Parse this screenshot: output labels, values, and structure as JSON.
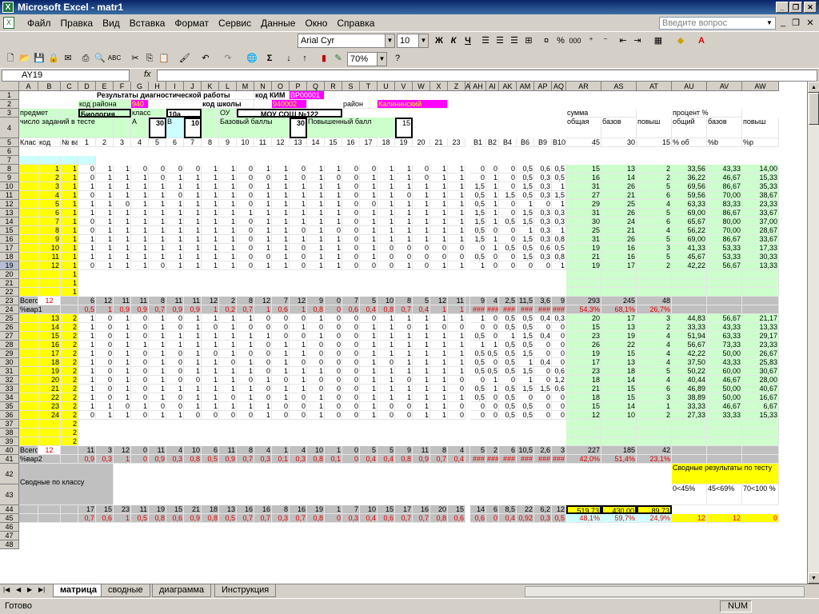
{
  "window": {
    "title": "Microsoft Excel - matr1",
    "icon": "excel-icon",
    "min": "_",
    "restore": "❐",
    "close": "✕"
  },
  "menu": [
    "Файл",
    "Правка",
    "Вид",
    "Вставка",
    "Формат",
    "Сервис",
    "Данные",
    "Окно",
    "Справка"
  ],
  "help_placeholder": "Введите вопрос",
  "toolbar": {
    "font": "Arial Cyr",
    "size": "10",
    "bold": "Ж",
    "italic": "К",
    "underline": "Ч",
    "zoom": "70%",
    "currency": "%",
    "thousands": "000"
  },
  "formula": {
    "cell": "AY19",
    "fx": "fx",
    "value": ""
  },
  "columns": [
    "A",
    "B",
    "C",
    "D",
    "E",
    "F",
    "G",
    "H",
    "I",
    "J",
    "K",
    "L",
    "M",
    "N",
    "O",
    "P",
    "Q",
    "R",
    "S",
    "T",
    "U",
    "V",
    "W",
    "X",
    "Z",
    "A",
    "AH",
    "AI",
    "AK",
    "AM",
    "AP",
    "AQ",
    "AR",
    "AS",
    "AT",
    "AU",
    "AV",
    "AW"
  ],
  "rows_visible": [
    "1",
    "2",
    "3",
    "4",
    "5",
    "6",
    "7",
    "8",
    "9",
    "10",
    "11",
    "12",
    "13",
    "14",
    "15",
    "16",
    "17",
    "18",
    "19",
    "20",
    "21",
    "22",
    "23",
    "24",
    "25",
    "26",
    "27",
    "28",
    "29",
    "30",
    "31",
    "32",
    "33",
    "34",
    "35",
    "36",
    "37",
    "38",
    "39",
    "40",
    "41",
    "42",
    "43",
    "44",
    "45",
    "46",
    "47",
    "48"
  ],
  "header": {
    "title": "Результаты диагностической работы",
    "kim_label": "код КИМ",
    "kim": "BP00001",
    "district_code_label": "код района",
    "district_code": "940",
    "school_code_label": "код школы",
    "school_code": "940002",
    "district_label": "район",
    "district": "Калининский",
    "subject_label": "предмет",
    "subject": "Биология",
    "class_label": "класс",
    "class": "10а",
    "ou_label": "ОУ",
    "ou": "МОУ СОШ №122",
    "tasks_label": "число заданий в тесте",
    "a_label": "А",
    "a_count": "30",
    "b_label": "В",
    "b_count": "10",
    "base_label": "Базовый баллы",
    "base": "30",
    "adv_label": "Повышенный балл",
    "adv": "15",
    "sum_label": "сумма",
    "pct_label": "процент %",
    "total": "общая",
    "base_col": "базов",
    "adv_col": "повыш",
    "pct_total": "общий",
    "pct_base": "базов",
    "pct_adv": "повыш",
    "class_h": "Клас с",
    "code_h": "код",
    "var_h": "№ вар",
    "total_max": "45",
    "base_max": "30",
    "adv_max": "15",
    "pct_h1": "% об",
    "pct_h2": "%b",
    "pct_h3": "%p",
    "task_nums": [
      "1",
      "2",
      "3",
      "4",
      "5",
      "6",
      "7",
      "8",
      "9",
      "10",
      "11",
      "12",
      "13",
      "14",
      "15",
      "16",
      "17",
      "18",
      "19",
      "20",
      "21",
      "23",
      "B1",
      "B2",
      "B4",
      "B6",
      "B9",
      "B10"
    ]
  },
  "block1": [
    {
      "code": "1",
      "var": "1",
      "v": [
        "0",
        "1",
        "1",
        "0",
        "0",
        "0",
        "0",
        "1",
        "1",
        "0",
        "1",
        "1",
        "0",
        "1",
        "1",
        "0",
        "0",
        "1",
        "1",
        "0",
        "1",
        "1",
        "0",
        "0",
        "0",
        "0,5",
        "0,6",
        "0,5"
      ],
      "s": [
        "15",
        "13",
        "2"
      ],
      "p": [
        "33,56",
        "43,33",
        "14,00"
      ]
    },
    {
      "code": "2",
      "var": "1",
      "v": [
        "0",
        "1",
        "1",
        "1",
        "0",
        "1",
        "1",
        "1",
        "1",
        "0",
        "0",
        "1",
        "0",
        "1",
        "0",
        "0",
        "1",
        "1",
        "1",
        "0",
        "1",
        "1",
        "0",
        "1",
        "0",
        "0,5",
        "0,3",
        "0,5"
      ],
      "s": [
        "16",
        "14",
        "2"
      ],
      "p": [
        "36,22",
        "46,67",
        "15,33"
      ]
    },
    {
      "code": "3",
      "var": "1",
      "v": [
        "1",
        "1",
        "1",
        "1",
        "1",
        "1",
        "1",
        "1",
        "1",
        "0",
        "1",
        "1",
        "1",
        "1",
        "1",
        "0",
        "1",
        "1",
        "1",
        "1",
        "1",
        "1",
        "1,5",
        "1",
        "0",
        "1,5",
        "0,3",
        "1"
      ],
      "s": [
        "31",
        "26",
        "5"
      ],
      "p": [
        "69,56",
        "86,67",
        "35,33"
      ]
    },
    {
      "code": "4",
      "var": "1",
      "v": [
        "0",
        "1",
        "1",
        "1",
        "1",
        "0",
        "1",
        "1",
        "1",
        "0",
        "1",
        "1",
        "1",
        "1",
        "1",
        "0",
        "1",
        "1",
        "0",
        "1",
        "1",
        "1",
        "0,5",
        "1",
        "1,5",
        "0,5",
        "0,3",
        "1,5"
      ],
      "s": [
        "27",
        "21",
        "6"
      ],
      "p": [
        "59,56",
        "70,00",
        "38,67"
      ]
    },
    {
      "code": "5",
      "var": "1",
      "v": [
        "1",
        "1",
        "0",
        "1",
        "1",
        "1",
        "1",
        "1",
        "1",
        "0",
        "1",
        "1",
        "1",
        "1",
        "1",
        "0",
        "0",
        "1",
        "1",
        "1",
        "1",
        "1",
        "0,5",
        "1",
        "0",
        "1",
        "0",
        "1"
      ],
      "s": [
        "29",
        "25",
        "4"
      ],
      "p": [
        "63,33",
        "83,33",
        "23,33"
      ]
    },
    {
      "code": "6",
      "var": "1",
      "v": [
        "1",
        "1",
        "1",
        "1",
        "1",
        "1",
        "1",
        "1",
        "1",
        "1",
        "1",
        "1",
        "1",
        "1",
        "1",
        "0",
        "1",
        "1",
        "1",
        "1",
        "1",
        "1",
        "1,5",
        "1",
        "0",
        "1,5",
        "0,3",
        "0,3"
      ],
      "s": [
        "31",
        "26",
        "5"
      ],
      "p": [
        "69,00",
        "86,67",
        "33,67"
      ]
    },
    {
      "code": "7",
      "var": "1",
      "v": [
        "0",
        "1",
        "1",
        "1",
        "1",
        "1",
        "1",
        "1",
        "1",
        "0",
        "1",
        "1",
        "1",
        "1",
        "1",
        "0",
        "1",
        "1",
        "1",
        "1",
        "1",
        "1",
        "1,5",
        "1",
        "0,5",
        "1,5",
        "0,3",
        "0,3"
      ],
      "s": [
        "30",
        "24",
        "6"
      ],
      "p": [
        "65,67",
        "80,00",
        "37,00"
      ]
    },
    {
      "code": "8",
      "var": "1",
      "v": [
        "0",
        "1",
        "1",
        "1",
        "1",
        "1",
        "1",
        "1",
        "1",
        "0",
        "1",
        "1",
        "0",
        "1",
        "0",
        "0",
        "1",
        "1",
        "1",
        "1",
        "1",
        "1",
        "0,5",
        "0",
        "0",
        "1",
        "0,3",
        "1"
      ],
      "s": [
        "25",
        "21",
        "4"
      ],
      "p": [
        "56,22",
        "70,00",
        "28,67"
      ]
    },
    {
      "code": "9",
      "var": "1",
      "v": [
        "1",
        "1",
        "1",
        "1",
        "1",
        "1",
        "1",
        "1",
        "1",
        "0",
        "1",
        "1",
        "1",
        "1",
        "1",
        "0",
        "1",
        "1",
        "1",
        "1",
        "1",
        "1",
        "1,5",
        "1",
        "0",
        "1,5",
        "0,3",
        "0,8"
      ],
      "s": [
        "31",
        "26",
        "5"
      ],
      "p": [
        "69,00",
        "86,67",
        "33,67"
      ]
    },
    {
      "code": "10",
      "var": "1",
      "v": [
        "1",
        "1",
        "1",
        "1",
        "1",
        "1",
        "1",
        "1",
        "1",
        "0",
        "1",
        "1",
        "0",
        "1",
        "1",
        "0",
        "1",
        "0",
        "0",
        "0",
        "0",
        "0",
        "0",
        "1",
        "0,5",
        "0,5",
        "0,6",
        "0,5"
      ],
      "s": [
        "19",
        "16",
        "3"
      ],
      "p": [
        "41,33",
        "53,33",
        "17,33"
      ]
    },
    {
      "code": "11",
      "var": "1",
      "v": [
        "1",
        "1",
        "1",
        "1",
        "1",
        "1",
        "1",
        "1",
        "1",
        "0",
        "0",
        "1",
        "0",
        "1",
        "1",
        "0",
        "1",
        "0",
        "0",
        "0",
        "0",
        "0",
        "0,5",
        "0",
        "0",
        "1,5",
        "0,3",
        "0,8"
      ],
      "s": [
        "21",
        "16",
        "5"
      ],
      "p": [
        "45,67",
        "53,33",
        "30,33"
      ]
    },
    {
      "code": "12",
      "var": "1",
      "v": [
        "0",
        "1",
        "1",
        "1",
        "0",
        "1",
        "1",
        "1",
        "1",
        "0",
        "1",
        "1",
        "0",
        "1",
        "1",
        "0",
        "0",
        "0",
        "1",
        "0",
        "1",
        "1",
        "1",
        "0",
        "0",
        "0",
        "0",
        "1"
      ],
      "s": [
        "19",
        "17",
        "2"
      ],
      "p": [
        "42,22",
        "56,67",
        "13,33"
      ]
    }
  ],
  "block1_totals": {
    "label": "Всего",
    "count": "12",
    "v": [
      "6",
      "12",
      "11",
      "11",
      "8",
      "11",
      "11",
      "12",
      "2",
      "8",
      "12",
      "7",
      "12",
      "9",
      "0",
      "7",
      "5",
      "10",
      "8",
      "5",
      "12",
      "11",
      "9",
      "4",
      "2,5",
      "11,5",
      "3,6",
      "9"
    ],
    "s": [
      "293",
      "245",
      "48"
    ],
    "pct_label": "%вар1",
    "pv": [
      "0,5",
      "1",
      "0,9",
      "0,9",
      "0,7",
      "0,9",
      "0,9",
      "1",
      "0,2",
      "0,7",
      "1",
      "0,6",
      "1",
      "0,8",
      "0",
      "0,6",
      "0,4",
      "0,8",
      "0,7",
      "0,4",
      "1",
      "1",
      "###",
      "###",
      "###",
      "###",
      "###",
      "###"
    ],
    "ps": [
      "54,3%",
      "68,1%",
      "26,7%"
    ]
  },
  "block2": [
    {
      "code": "13",
      "var": "2",
      "v": [
        "1",
        "0",
        "1",
        "0",
        "1",
        "0",
        "1",
        "1",
        "1",
        "1",
        "0",
        "0",
        "0",
        "1",
        "0",
        "0",
        "0",
        "1",
        "1",
        "1",
        "1",
        "1",
        "1",
        "0",
        "0,5",
        "0,5",
        "0,4",
        "0,3"
      ],
      "s": [
        "20",
        "17",
        "3"
      ],
      "p": [
        "44,83",
        "56,67",
        "21,17"
      ]
    },
    {
      "code": "14",
      "var": "2",
      "v": [
        "1",
        "0",
        "1",
        "0",
        "1",
        "0",
        "1",
        "0",
        "1",
        "0",
        "0",
        "0",
        "1",
        "0",
        "0",
        "0",
        "1",
        "1",
        "0",
        "1",
        "0",
        "0",
        "0",
        "0",
        "0,5",
        "0,5",
        "0",
        "0"
      ],
      "s": [
        "15",
        "13",
        "2"
      ],
      "p": [
        "33,33",
        "43,33",
        "13,33"
      ]
    },
    {
      "code": "15",
      "var": "2",
      "v": [
        "1",
        "0",
        "1",
        "0",
        "1",
        "1",
        "1",
        "1",
        "1",
        "1",
        "1",
        "0",
        "0",
        "1",
        "0",
        "0",
        "1",
        "1",
        "1",
        "1",
        "1",
        "1",
        "0,5",
        "0",
        "1",
        "1,5",
        "0,4",
        "0"
      ],
      "s": [
        "23",
        "19",
        "4"
      ],
      "p": [
        "51,94",
        "63,33",
        "29,17"
      ]
    },
    {
      "code": "16",
      "var": "2",
      "v": [
        "1",
        "0",
        "1",
        "1",
        "1",
        "1",
        "1",
        "1",
        "1",
        "1",
        "0",
        "1",
        "1",
        "0",
        "0",
        "0",
        "1",
        "1",
        "1",
        "1",
        "1",
        "1",
        "1",
        "1",
        "0,5",
        "0,5",
        "0",
        "0"
      ],
      "s": [
        "26",
        "22",
        "4"
      ],
      "p": [
        "56,67",
        "73,33",
        "23,33"
      ]
    },
    {
      "code": "17",
      "var": "2",
      "v": [
        "1",
        "0",
        "1",
        "0",
        "1",
        "0",
        "1",
        "0",
        "1",
        "0",
        "0",
        "1",
        "1",
        "0",
        "0",
        "0",
        "1",
        "1",
        "1",
        "1",
        "1",
        "1",
        "0,5",
        "0,5",
        "0,5",
        "1,5",
        "0",
        "0"
      ],
      "s": [
        "19",
        "15",
        "4"
      ],
      "p": [
        "42,22",
        "50,00",
        "26,67"
      ]
    },
    {
      "code": "18",
      "var": "2",
      "v": [
        "1",
        "0",
        "1",
        "0",
        "1",
        "0",
        "1",
        "1",
        "0",
        "1",
        "0",
        "1",
        "0",
        "0",
        "0",
        "0",
        "1",
        "0",
        "1",
        "1",
        "1",
        "1",
        "0,5",
        "0",
        "0,5",
        "1",
        "0,4",
        "0"
      ],
      "s": [
        "17",
        "13",
        "4"
      ],
      "p": [
        "37,50",
        "43,33",
        "25,83"
      ]
    },
    {
      "code": "19",
      "var": "2",
      "v": [
        "1",
        "0",
        "1",
        "0",
        "1",
        "0",
        "1",
        "1",
        "1",
        "1",
        "0",
        "1",
        "1",
        "1",
        "0",
        "0",
        "1",
        "1",
        "1",
        "1",
        "1",
        "1",
        "0,5",
        "0,5",
        "0,5",
        "1,5",
        "0",
        "0,6"
      ],
      "s": [
        "23",
        "18",
        "5"
      ],
      "p": [
        "50,22",
        "60,00",
        "30,67"
      ]
    },
    {
      "code": "20",
      "var": "2",
      "v": [
        "1",
        "0",
        "1",
        "0",
        "1",
        "0",
        "0",
        "1",
        "1",
        "0",
        "1",
        "0",
        "1",
        "0",
        "0",
        "0",
        "1",
        "1",
        "0",
        "1",
        "1",
        "0",
        "0",
        "1",
        "0",
        "1",
        "0",
        "1,2"
      ],
      "s": [
        "18",
        "14",
        "4"
      ],
      "p": [
        "40,44",
        "46,67",
        "28,00"
      ]
    },
    {
      "code": "21",
      "var": "2",
      "v": [
        "1",
        "0",
        "1",
        "0",
        "1",
        "1",
        "1",
        "1",
        "1",
        "1",
        "0",
        "1",
        "1",
        "0",
        "0",
        "0",
        "1",
        "1",
        "1",
        "1",
        "1",
        "0",
        "0,5",
        "1",
        "0,5",
        "1,5",
        "1,5",
        "0,6"
      ],
      "s": [
        "21",
        "15",
        "6"
      ],
      "p": [
        "46,89",
        "50,00",
        "40,67"
      ]
    },
    {
      "code": "22",
      "var": "2",
      "v": [
        "1",
        "0",
        "1",
        "0",
        "1",
        "0",
        "1",
        "1",
        "0",
        "1",
        "0",
        "1",
        "0",
        "1",
        "0",
        "0",
        "1",
        "1",
        "1",
        "1",
        "1",
        "1",
        "0,5",
        "0",
        "0,5",
        "0",
        "0",
        "0"
      ],
      "s": [
        "18",
        "15",
        "3"
      ],
      "p": [
        "38,89",
        "50,00",
        "16,67"
      ]
    },
    {
      "code": "23",
      "var": "2",
      "v": [
        "1",
        "1",
        "0",
        "1",
        "0",
        "0",
        "1",
        "1",
        "1",
        "1",
        "1",
        "0",
        "0",
        "1",
        "0",
        "0",
        "1",
        "0",
        "0",
        "1",
        "1",
        "0",
        "0",
        "0",
        "0,5",
        "0,5",
        "0",
        "0"
      ],
      "s": [
        "15",
        "14",
        "1"
      ],
      "p": [
        "33,33",
        "46,67",
        "6,67"
      ]
    },
    {
      "code": "24",
      "var": "2",
      "v": [
        "0",
        "1",
        "1",
        "0",
        "1",
        "1",
        "0",
        "0",
        "0",
        "0",
        "1",
        "0",
        "0",
        "1",
        "0",
        "0",
        "1",
        "0",
        "0",
        "1",
        "1",
        "0",
        "0",
        "0",
        "0,5",
        "0,5",
        "0",
        "0"
      ],
      "s": [
        "12",
        "10",
        "2"
      ],
      "p": [
        "27,33",
        "33,33",
        "15,33"
      ]
    }
  ],
  "block2_totals": {
    "label": "Всего",
    "count": "12",
    "v": [
      "11",
      "3",
      "12",
      "0",
      "11",
      "4",
      "10",
      "6",
      "11",
      "8",
      "4",
      "1",
      "4",
      "10",
      "1",
      "0",
      "5",
      "5",
      "9",
      "11",
      "8",
      "4",
      "5",
      "2",
      "6",
      "10,5",
      "2,6",
      "3"
    ],
    "s": [
      "227",
      "185",
      "42"
    ],
    "pct_label": "%вар2",
    "pv": [
      "0,9",
      "0,3",
      "1",
      "0",
      "0,9",
      "0,3",
      "0,8",
      "0,5",
      "0,9",
      "0,7",
      "0,3",
      "0,1",
      "0,3",
      "0,8",
      "0,1",
      "0",
      "0,4",
      "0,4",
      "0,8",
      "0,9",
      "0,7",
      "0,4",
      "###",
      "###",
      "###",
      "###",
      "###",
      "###"
    ],
    "ps": [
      "42,0%",
      "51,4%",
      "23,1%"
    ]
  },
  "summary": {
    "label": "Сводные по классу",
    "tests_title": "Сводные результаты по тесту",
    "b1": "0<45%",
    "b2": "45<69%",
    "b3": "70<100 %",
    "v": [
      "17",
      "15",
      "23",
      "11",
      "19",
      "15",
      "21",
      "18",
      "13",
      "16",
      "16",
      "8",
      "16",
      "19",
      "1",
      "7",
      "10",
      "15",
      "17",
      "16",
      "20",
      "15",
      "14",
      "6",
      "8,5",
      "22",
      "6,2",
      "12"
    ],
    "s": [
      "519,73",
      "430,00",
      "89,73"
    ],
    "pv": [
      "0,7",
      "0,6",
      "1",
      "0,5",
      "0,8",
      "0,6",
      "0,9",
      "0,8",
      "0,5",
      "0,7",
      "0,7",
      "0,3",
      "0,7",
      "0,8",
      "0",
      "0,3",
      "0,4",
      "0,6",
      "0,7",
      "0,7",
      "0,8",
      "0,6",
      "0,6",
      "0",
      "0,4",
      "0,92",
      "0,3",
      "0,5"
    ],
    "ps": [
      "48,1%",
      "59,7%",
      "24,9%"
    ],
    "bands": [
      "12",
      "12",
      "0"
    ]
  },
  "sheets": [
    "матрица",
    "сводные",
    "диаграмма",
    "Инструкция"
  ],
  "status": {
    "ready": "Готово",
    "num": "NUM"
  },
  "colors": {
    "yellow": "#ffff00",
    "cyan": "#ccffff",
    "green": "#ccffcc",
    "magenta": "#ff00ff",
    "gray": "#c0c0c0",
    "red": "#e00000"
  }
}
